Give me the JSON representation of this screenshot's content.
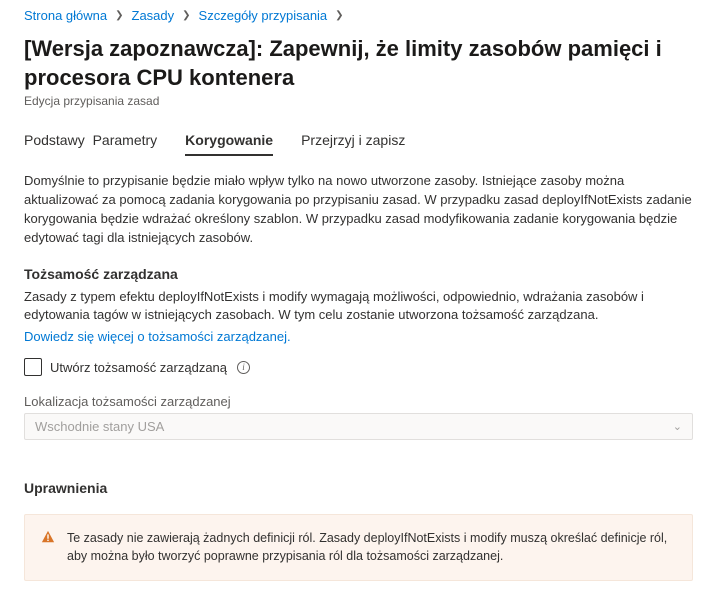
{
  "breadcrumb": {
    "home": "Strona główna",
    "policies": "Zasady",
    "assignment": "Szczegóły przypisania"
  },
  "title": "[Wersja zapoznawcza]: Zapewnij, że limity zasobów pamięci i procesora CPU kontenera",
  "subtitle": "Edycja przypisania zasad",
  "tabs": {
    "basics": "Podstawy",
    "parameters": "Parametry",
    "remediation": "Korygowanie",
    "review": "Przejrzyj i zapisz"
  },
  "intro": "Domyślnie to przypisanie będzie miało wpływ tylko na nowo utworzone zasoby. Istniejące zasoby można aktualizować za pomocą zadania korygowania po przypisaniu zasad. W przypadku zasad deployIfNotExists zadanie korygowania będzie wdrażać określony szablon. W przypadku zasad modyfikowania zadanie korygowania będzie edytować tagi dla istniejących zasobów.",
  "managedIdentity": {
    "heading": "Tożsamość zarządzana",
    "text": "Zasady z typem efektu deployIfNotExists i modify wymagają możliwości, odpowiednio, wdrażania zasobów i edytowania tagów w istniejących zasobach. W tym celu zostanie utworzona tożsamość zarządzana.",
    "learnMore": "Dowiedz się więcej o tożsamości zarządzanej.",
    "checkboxLabel": "Utwórz tożsamość zarządzaną",
    "locationLabel": "Lokalizacja tożsamości zarządzanej",
    "locationValue": "Wschodnie stany USA"
  },
  "permissions": {
    "heading": "Uprawnienia",
    "warning": "Te zasady nie zawierają żadnych definicji ról. Zasady deployIfNotExists i modify muszą określać definicje ról, aby można było tworzyć poprawne przypisania ról dla tożsamości zarządzanej."
  }
}
